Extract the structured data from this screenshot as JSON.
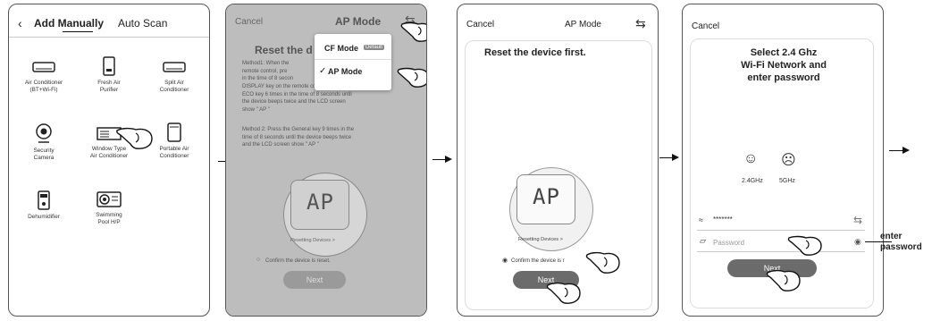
{
  "screen1": {
    "back_icon": "chevron-left-icon",
    "tabs": {
      "add_manually": "Add Manually",
      "auto_scan": "Auto Scan"
    },
    "devices": [
      {
        "label": "Air Conditioner\n(BT+Wi-Fi)",
        "icon": "ac-unit-icon"
      },
      {
        "label": "Fresh Air\nPurifier",
        "icon": "air-purifier-icon"
      },
      {
        "label": "Split Air\nConditioner",
        "icon": "split-ac-icon"
      },
      {
        "label": "Security\nCamera",
        "icon": "camera-icon"
      },
      {
        "label": "Window Type\nAir Conditioner",
        "icon": "window-ac-icon"
      },
      {
        "label": "Portable Air\nConditioner",
        "icon": "portable-ac-icon"
      },
      {
        "label": "Dehumidifier",
        "icon": "dehumidifier-icon"
      },
      {
        "label": "Swimming\nPool H/P",
        "icon": "pool-heat-pump-icon"
      }
    ]
  },
  "screen2": {
    "cancel": "Cancel",
    "mode_title": "AP Mode",
    "switch_icon": "switch-arrows-icon",
    "heading": "Reset the d",
    "method1": "Method1: When the\nremote control, pre\nin the time of 8 secon\nDISPLAY key on the remote control, press the\nECO key 6 times in the time of 8 seconds until\nthe device beeps twice and the LCD screen\nshow \" AP \"",
    "method2": "Method 2: Press the General key 9 times in the\ntime of 8 seconds until the device beeps twice\nand the LCD screen show \" AP \"",
    "display_text": "AP",
    "resetting": "Resetting Devices >",
    "confirm": "Confirm the device is reset.",
    "next": "Next",
    "dropdown": {
      "cf_mode": "CF Mode",
      "default_badge": "Default",
      "ap_mode": "AP Mode",
      "check_icon": "check-icon"
    }
  },
  "screen3": {
    "cancel": "Cancel",
    "mode_title": "AP Mode",
    "switch_icon": "switch-arrows-icon",
    "heading": "Reset the device first.",
    "display_text": "AP",
    "resetting": "Resetting Devices >",
    "confirm": "Confirm the device is r",
    "next": "Next"
  },
  "screen4": {
    "cancel": "Cancel",
    "heading": "Select 2.4 Ghz\nWi-Fi Network and\nenter password",
    "band_good": "2.4GHz",
    "band_bad": "5GHz",
    "ssid": "*******",
    "password_placeholder": "Password",
    "next": "Next"
  },
  "annotation": {
    "enter_password": "enter\npassword"
  },
  "colors": {
    "button": "#6b6b6b",
    "border": "#555555",
    "overlay": "#bdbdbd",
    "arrow": "#111111"
  }
}
